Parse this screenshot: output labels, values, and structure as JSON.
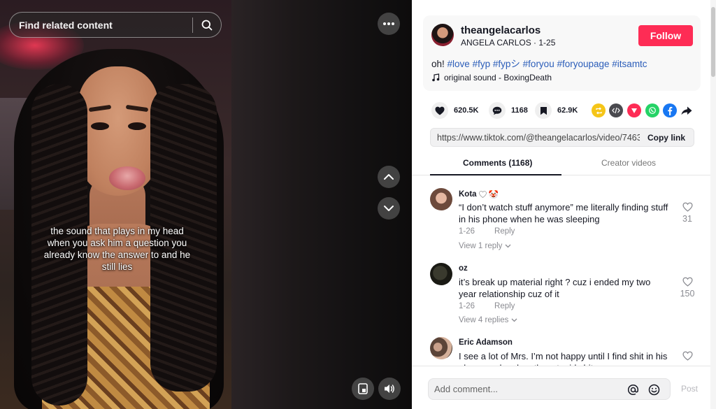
{
  "video": {
    "search_placeholder": "Find related content",
    "caption": "the sound that plays in my head when you ask him a question you already know the answer to and he still lies"
  },
  "author": {
    "username": "theangelacarlos",
    "display_line": "ANGELA CARLOS · 1-25",
    "follow_label": "Follow"
  },
  "description": {
    "prefix": "oh! ",
    "hashtags": [
      "#love",
      "#fyp",
      "#fypシ",
      "#foryou",
      "#foryoupage",
      "#itsamtc"
    ]
  },
  "music": {
    "label": "original sound - BoxingDeath"
  },
  "stats": {
    "likes": "620.5K",
    "comments": "1168",
    "saves": "62.9K"
  },
  "share": {
    "icons": [
      "repost-icon",
      "embed-icon",
      "send-icon",
      "whatsapp-icon",
      "facebook-icon",
      "share-arrow-icon"
    ]
  },
  "link": {
    "url": "https://www.tiktok.com/@theangelacarlos/video/7463...",
    "copy_label": "Copy link"
  },
  "tabs": {
    "comments": "Comments (1168)",
    "creator": "Creator videos"
  },
  "comments": [
    {
      "name": "Kota",
      "emoji": "🤡",
      "text": "“I don’t watch stuff anymore” me literally finding stuff in his phone when he was sleeping",
      "date": "1-26",
      "reply_label": "Reply",
      "view_replies": "View 1 reply",
      "likes": "31"
    },
    {
      "name": "oz",
      "text": "it’s break up material right ? cuz i ended my two year relationship cuz of it",
      "date": "1-26",
      "reply_label": "Reply",
      "view_replies": "View 4 replies",
      "likes": "150"
    },
    {
      "name": "Eric Adamson",
      "text": "I see a lot of Mrs. I’m not happy until I find shit in his phone and make other stupid shit up",
      "likes": ""
    }
  ],
  "composer": {
    "placeholder": "Add comment...",
    "post_label": "Post"
  },
  "colors": {
    "follow": "#fe2c55",
    "hashtag": "#2b5db9",
    "whatsapp": "#25d366",
    "facebook": "#1877f2",
    "repost": "#f5c518",
    "send": "#fe2c55"
  }
}
